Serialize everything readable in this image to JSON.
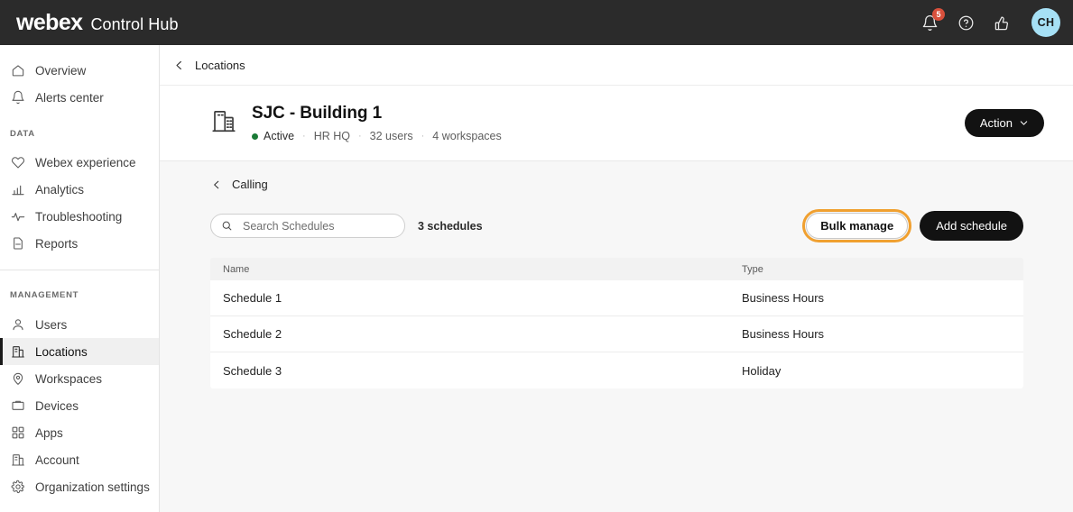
{
  "topbar": {
    "brand_name": "webex",
    "product_name": "Control Hub",
    "notifications_badge": "5",
    "notifications_icon": "bell-icon",
    "help_icon": "help-circle-icon",
    "feedback_icon": "thumbs-up-icon",
    "avatar_initials": "CH",
    "avatar_color": "#a6e0f5",
    "background_color": "#2b2b2b"
  },
  "sidebar": {
    "items": [
      {
        "label": "Overview",
        "icon": "home-icon",
        "active": false
      },
      {
        "label": "Alerts center",
        "icon": "bell-icon",
        "active": false
      }
    ],
    "group_data_label": "DATA",
    "data_items": [
      {
        "label": "Webex experience",
        "icon": "heart-icon",
        "active": false
      },
      {
        "label": "Analytics",
        "icon": "bar-chart-icon",
        "active": false
      },
      {
        "label": "Troubleshooting",
        "icon": "pulse-icon",
        "active": false
      },
      {
        "label": "Reports",
        "icon": "document-icon",
        "active": false
      }
    ],
    "group_management_label": "MANAGEMENT",
    "management_items": [
      {
        "label": "Users",
        "icon": "user-icon",
        "active": false
      },
      {
        "label": "Locations",
        "icon": "building-icon",
        "active": true
      },
      {
        "label": "Workspaces",
        "icon": "map-pin-icon",
        "active": false
      },
      {
        "label": "Devices",
        "icon": "device-icon",
        "active": false
      },
      {
        "label": "Apps",
        "icon": "grid-apps-icon",
        "active": false
      },
      {
        "label": "Account",
        "icon": "building-icon",
        "active": false
      },
      {
        "label": "Organization settings",
        "icon": "gear-icon",
        "active": false
      }
    ],
    "active_accent_color": "#1a1a1a"
  },
  "breadcrumb": {
    "back_icon": "chevron-left-icon",
    "label": "Locations"
  },
  "location_header": {
    "icon": "building-icon",
    "title": "SJC - Building 1",
    "status": "Active",
    "status_color": "#1a7a36",
    "org": "HR HQ",
    "users": "32 users",
    "workspaces": "4 workspaces",
    "separator": "·",
    "action_button": "Action",
    "action_chevron_icon": "chevron-down-icon"
  },
  "calling_panel": {
    "back_icon": "chevron-left-icon",
    "breadcrumb": "Calling",
    "search": {
      "icon": "search-icon",
      "placeholder": "Search Schedules",
      "value": ""
    },
    "count": "3 schedules",
    "bulk_manage_button": "Bulk manage",
    "bulk_manage_focus_color": "#f0a030",
    "add_schedule_button": "Add schedule"
  },
  "table": {
    "columns": [
      "Name",
      "Type"
    ],
    "rows": [
      {
        "name": "Schedule 1",
        "type": "Business Hours"
      },
      {
        "name": "Schedule 2",
        "type": "Business Hours"
      },
      {
        "name": "Schedule 3",
        "type": "Holiday"
      }
    ]
  }
}
